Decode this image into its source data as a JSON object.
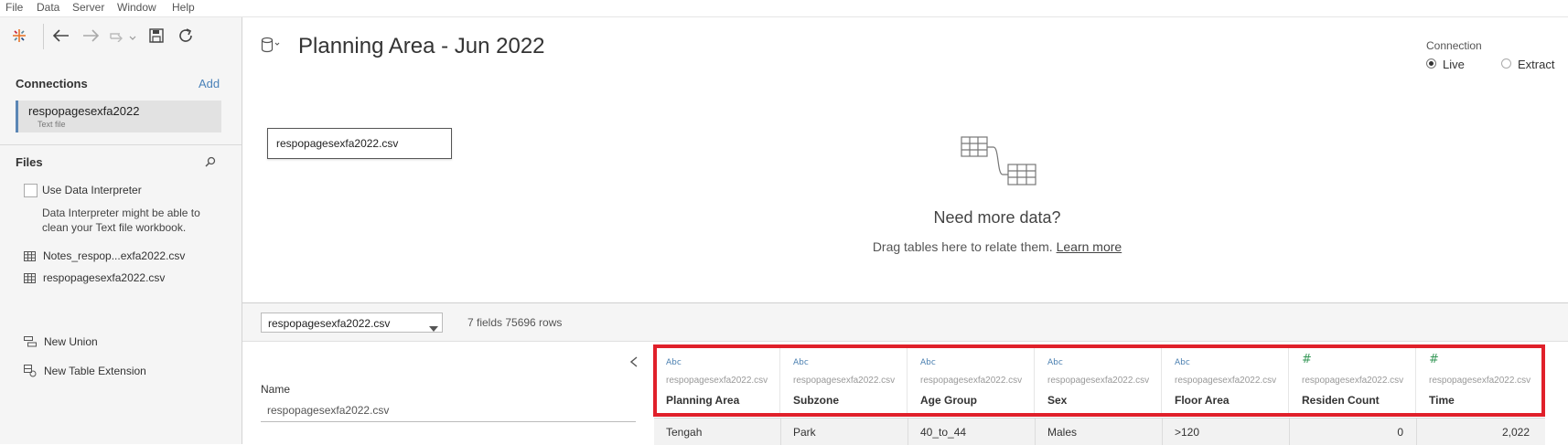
{
  "menu": [
    "File",
    "Data",
    "Server",
    "Window",
    "Help"
  ],
  "datasource": {
    "title": "Planning Area - Jun 2022",
    "connection_label": "Connection",
    "connection_options": [
      "Live",
      "Extract"
    ],
    "connection_selected": "Live"
  },
  "left": {
    "connections_title": "Connections",
    "add_label": "Add",
    "connection_name": "respopagesexfa2022",
    "connection_type": "Text file",
    "files_title": "Files",
    "interpreter_label": "Use Data Interpreter",
    "interpreter_hint_1": "Data Interpreter might be able to",
    "interpreter_hint_2": "clean your Text file workbook.",
    "files": [
      "Notes_respop...exfa2022.csv",
      "respopagesexfa2022.csv"
    ],
    "new_union": "New Union",
    "new_table_extension": "New Table Extension"
  },
  "canvas": {
    "table_name": "respopagesexfa2022.csv",
    "need_more": "Need more data?",
    "drag_hint": "Drag tables here to relate them.",
    "learn_more": "Learn more"
  },
  "grid_bar": {
    "table_select": "respopagesexfa2022.csv",
    "summary": "7 fields 75696 rows"
  },
  "name_panel": {
    "label": "Name",
    "value": "respopagesexfa2022.csv"
  },
  "fields": [
    {
      "type": "Abc",
      "source": "respopagesexfa2022.csv",
      "name": "Planning Area"
    },
    {
      "type": "Abc",
      "source": "respopagesexfa2022.csv",
      "name": "Subzone"
    },
    {
      "type": "Abc",
      "source": "respopagesexfa2022.csv",
      "name": "Age Group"
    },
    {
      "type": "Abc",
      "source": "respopagesexfa2022.csv",
      "name": "Sex"
    },
    {
      "type": "Abc",
      "source": "respopagesexfa2022.csv",
      "name": "Floor Area"
    },
    {
      "type": "#",
      "source": "respopagesexfa2022.csv",
      "name": "Residen Count"
    },
    {
      "type": "#",
      "source": "respopagesexfa2022.csv",
      "name": "Time"
    }
  ],
  "row": [
    "Tengah",
    "Park",
    "40_to_44",
    "Males",
    ">120",
    "0",
    "2,022"
  ],
  "colors": {
    "highlight": "#e0202a",
    "accent": "#5b86b5",
    "string_type": "#4a7fb0",
    "number_type": "#3a9a5b"
  }
}
